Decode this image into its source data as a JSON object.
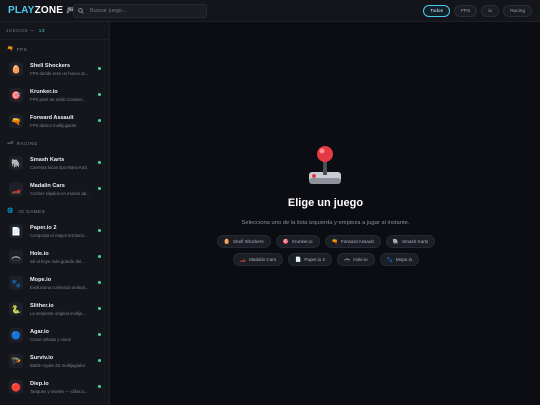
{
  "header": {
    "logo_play": "PLAY",
    "logo_zone": "ZONE",
    "logo_icon": "🎮",
    "search_placeholder": "Buscar juego...",
    "search_icon": "magnifier-icon",
    "filters": [
      {
        "label": "Todos",
        "active": true
      },
      {
        "label": "FPS",
        "active": false
      },
      {
        "label": "io",
        "active": false
      },
      {
        "label": "Racing",
        "active": false
      }
    ]
  },
  "sidebar": {
    "heading": "JUEGOS —",
    "count": "13",
    "categories": [
      {
        "icon": "🔫",
        "label": "FPS",
        "games": [
          {
            "icon": "🥚",
            "name": "Shell Shockers",
            "desc": "FPS donde eres un huevo ar..."
          },
          {
            "icon": "🎯",
            "name": "Krunker.io",
            "desc": "FPS pixel art estilo Counter..."
          },
          {
            "icon": "🔫",
            "name": "Forward Assault",
            "desc": "FPS táctico multijugador"
          }
        ]
      },
      {
        "icon": "🏎",
        "label": "RACING",
        "games": [
          {
            "icon": "🐘",
            "name": "Smash Karts",
            "desc": "Carreras locas tipo Mario Kart"
          },
          {
            "icon": "🏎️",
            "name": "Madalin Cars",
            "desc": "Coches rápidos en mundo ab..."
          }
        ]
      },
      {
        "icon": "🌐",
        "label": ".IO GAMES",
        "games": [
          {
            "icon": "📄",
            "name": "Paper.io 2",
            "desc": "Conquista el mayor territorio..."
          },
          {
            "icon": "🕳️",
            "name": "Hole.io",
            "desc": "Sé el hoyo más grande del..."
          },
          {
            "icon": "🐾",
            "name": "Mope.io",
            "desc": "Evoluciona comiendo animal..."
          },
          {
            "icon": "🐍",
            "name": "Slither.io",
            "desc": "La serpiente original multiju..."
          },
          {
            "icon": "🔵",
            "name": "Agar.io",
            "desc": "Come células y crece"
          },
          {
            "icon": "🪂",
            "name": "Surviv.io",
            "desc": "Battle royale 2D multijugador"
          },
          {
            "icon": "🔴",
            "name": "Diep.io",
            "desc": "Tanques y niveles — clásico..."
          }
        ]
      }
    ]
  },
  "main": {
    "icon": "🕹️",
    "title": "Elige un juego",
    "subtitle": "Selecciona uno de la lista izquierda y empieza a jugar al instante.",
    "chips": [
      {
        "icon": "🥚",
        "label": "Shell Shockers"
      },
      {
        "icon": "🎯",
        "label": "Krunker.io"
      },
      {
        "icon": "🔫",
        "label": "Forward Assault"
      },
      {
        "icon": "🐘",
        "label": "Smash Karts"
      },
      {
        "icon": "🏎️",
        "label": "Madalin Cars"
      },
      {
        "icon": "📄",
        "label": "Paper.io 2"
      },
      {
        "icon": "🕳️",
        "label": "Hole.io"
      },
      {
        "icon": "🐾",
        "label": "Mope.io"
      }
    ]
  }
}
